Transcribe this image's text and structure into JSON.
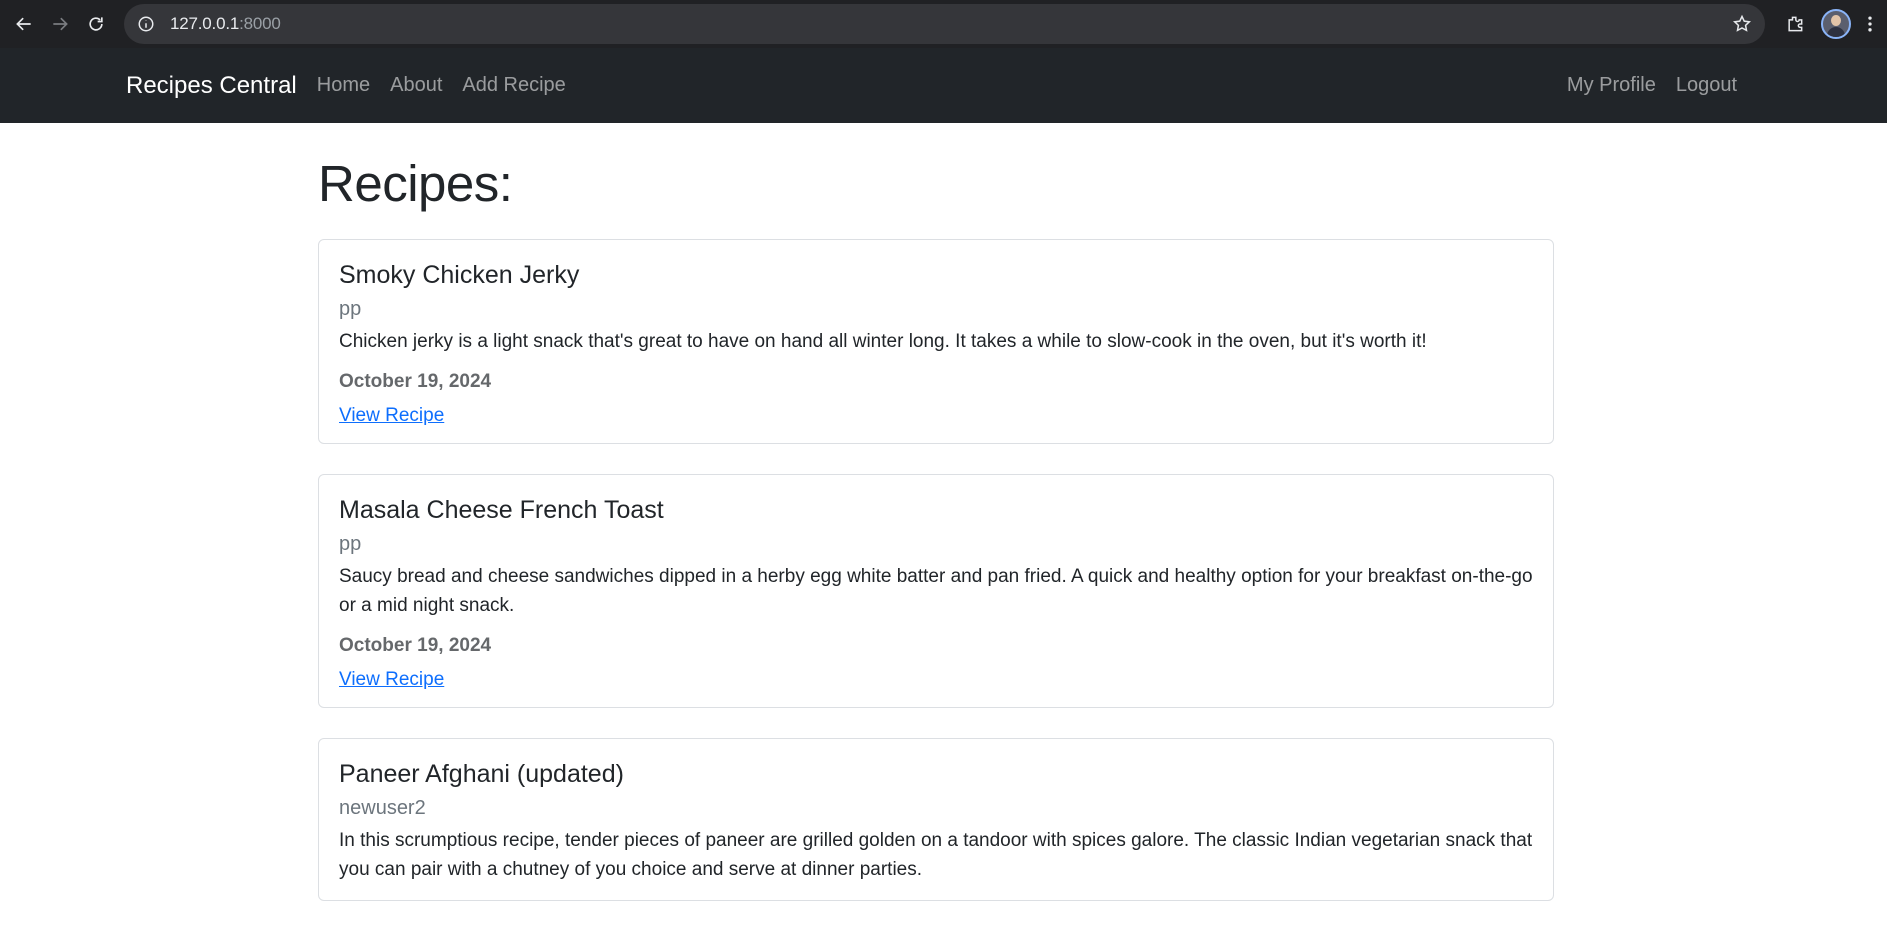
{
  "browser": {
    "url_host": "127.0.0.1",
    "url_port": ":8000",
    "icons": [
      "back-icon",
      "forward-icon",
      "reload-icon",
      "site-info-icon",
      "bookmark-star-icon",
      "extensions-icon",
      "profile-avatar",
      "menu-dots-icon"
    ]
  },
  "navbar": {
    "brand": "Recipes Central",
    "left_links": [
      "Home",
      "About",
      "Add Recipe"
    ],
    "right_links": [
      "My Profile",
      "Logout"
    ]
  },
  "main": {
    "title": "Recipes:",
    "recipes": [
      {
        "title": "Smoky Chicken Jerky",
        "author": "pp",
        "description": "Chicken jerky is a light snack that's great to have on hand all winter long. It takes a while to slow-cook in the oven, but it's worth it!",
        "date": "October 19, 2024",
        "link": "View Recipe"
      },
      {
        "title": "Masala Cheese French Toast",
        "author": "pp",
        "description": "Saucy bread and cheese sandwiches dipped in a herby egg white batter and pan fried. A quick and healthy option for your breakfast on-the-go or a mid night snack.",
        "date": "October 19, 2024",
        "link": "View Recipe"
      },
      {
        "title": "Paneer Afghani (updated)",
        "author": "newuser2",
        "description": "In this scrumptious recipe, tender pieces of paneer are grilled golden on a tandoor with spices galore. The classic Indian vegetarian snack that you can pair with a chutney of you choice and serve at dinner parties.",
        "date": "",
        "link": ""
      }
    ]
  },
  "colors": {
    "navbar_bg": "#212529",
    "chrome_bg": "#202124",
    "link": "#0d6efd"
  }
}
